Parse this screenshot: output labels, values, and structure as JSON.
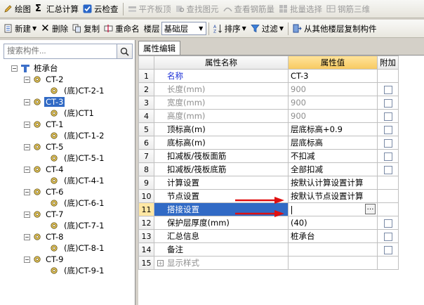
{
  "toolbar1": {
    "draw": "绘图",
    "sum_calc": "汇总计算",
    "cloud_check": "云检查",
    "align_slab": "平齐板顶",
    "find_element": "查找图元",
    "view_rebar_qty": "查看钢筋量",
    "batch_select": "批量选择",
    "rebar_3d": "钢筋三维"
  },
  "toolbar2": {
    "new": "新建",
    "delete": "删除",
    "copy": "复制",
    "rename": "重命名",
    "floor_label": "楼层",
    "floor_value": "基础层",
    "sort": "排序",
    "filter": "过滤",
    "copy_from_floor": "从其他楼层复制构件"
  },
  "left": {
    "search_placeholder": "搜索构件...",
    "root": "桩承台",
    "groups": [
      {
        "name": "CT-2",
        "child": "(底)CT-2-1"
      },
      {
        "name": "CT-3",
        "child": "(底)CT1"
      },
      {
        "name": "CT-1",
        "child": "(底)CT-1-2"
      },
      {
        "name": "CT-5",
        "child": "(底)CT-5-1"
      },
      {
        "name": "CT-4",
        "child": "(底)CT-4-1"
      },
      {
        "name": "CT-6",
        "child": "(底)CT-6-1"
      },
      {
        "name": "CT-7",
        "child": "(底)CT-7-1"
      },
      {
        "name": "CT-8",
        "child": "(底)CT-8-1"
      },
      {
        "name": "CT-9",
        "child": "(底)CT-9-1"
      }
    ]
  },
  "right": {
    "tab": "属性编辑",
    "headers": {
      "name": "属性名称",
      "value": "属性值",
      "extra": "附加"
    },
    "rows": [
      {
        "num": "1",
        "name": "名称",
        "value": "CT-3",
        "style": "blue",
        "chk": false
      },
      {
        "num": "2",
        "name": "长度(mm)",
        "value": "900",
        "style": "grey",
        "chk": true
      },
      {
        "num": "3",
        "name": "宽度(mm)",
        "value": "900",
        "style": "grey",
        "chk": true
      },
      {
        "num": "4",
        "name": "高度(mm)",
        "value": "900",
        "style": "grey",
        "chk": true
      },
      {
        "num": "5",
        "name": "顶标高(m)",
        "value": "层底标高+0.9",
        "style": "",
        "chk": true
      },
      {
        "num": "6",
        "name": "底标高(m)",
        "value": "层底标高",
        "style": "",
        "chk": true
      },
      {
        "num": "7",
        "name": "扣减板/筏板面筋",
        "value": "不扣减",
        "style": "",
        "chk": true
      },
      {
        "num": "8",
        "name": "扣减板/筏板底筋",
        "value": "全部扣减",
        "style": "",
        "chk": true
      },
      {
        "num": "9",
        "name": "计算设置",
        "value": "按默认计算设置计算",
        "style": "",
        "chk": false
      },
      {
        "num": "10",
        "name": "节点设置",
        "value": "按默认节点设置计算",
        "style": "",
        "chk": false
      },
      {
        "num": "11",
        "name": "搭接设置",
        "value": "",
        "style": "sel",
        "chk": false
      },
      {
        "num": "12",
        "name": "保护层厚度(mm)",
        "value": "(40)",
        "style": "",
        "chk": true
      },
      {
        "num": "13",
        "name": "汇总信息",
        "value": "桩承台",
        "style": "",
        "chk": true
      },
      {
        "num": "14",
        "name": "备注",
        "value": "",
        "style": "",
        "chk": true
      },
      {
        "num": "15",
        "name": "显示样式",
        "value": "",
        "style": "grey",
        "chk": false
      }
    ]
  },
  "colors": {
    "selection": "#316ac5",
    "header_value": "#f7c960",
    "arrow": "#e01010"
  }
}
